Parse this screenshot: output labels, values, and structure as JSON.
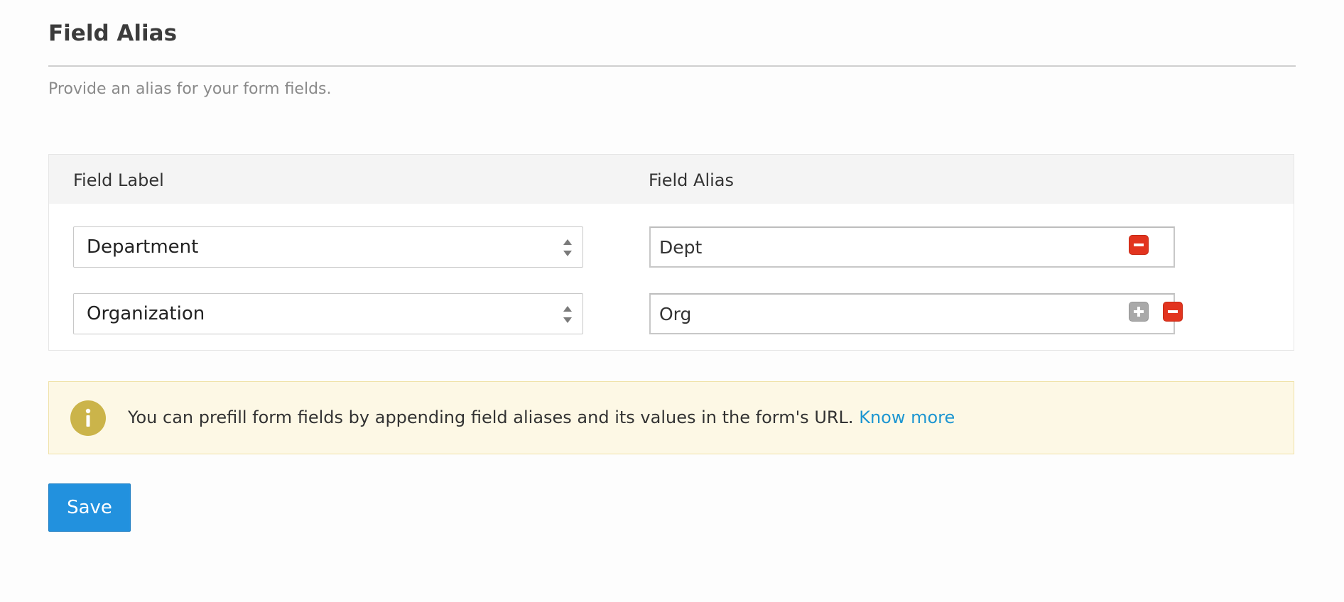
{
  "header": {
    "title": "Field Alias",
    "subtitle": "Provide an alias for your form fields."
  },
  "table": {
    "columns": {
      "label": "Field Label",
      "alias": "Field Alias"
    },
    "rows": [
      {
        "field_label": "Department",
        "field_alias": "Dept",
        "actions": [
          "remove-icon"
        ]
      },
      {
        "field_label": "Organization",
        "field_alias": "Org",
        "actions": [
          "add-icon",
          "remove-icon"
        ]
      }
    ]
  },
  "info": {
    "message": "You can prefill form fields by appending field aliases and its values in the form's URL.",
    "link_label": "Know more",
    "icon": "info-icon"
  },
  "actions": {
    "save_label": "Save"
  },
  "colors": {
    "accent": "#2291de",
    "remove": "#e2341f",
    "add": "#a9a9a9",
    "info_background": "#fdf8e5",
    "info_icon": "#cbb44a",
    "link": "#1e96d1"
  }
}
